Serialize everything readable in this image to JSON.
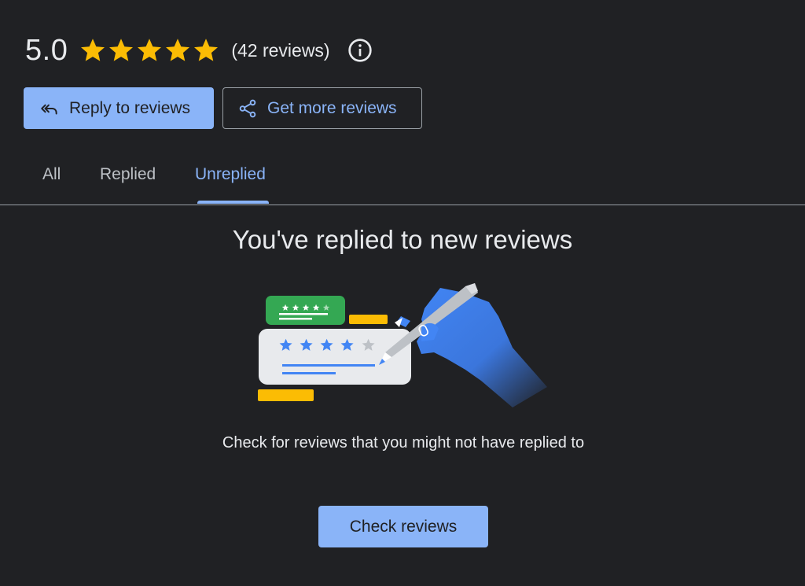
{
  "rating": {
    "value": "5.0",
    "stars": 5,
    "star_color": "#fbbc04",
    "review_count": "(42 reviews)",
    "info_icon": "info-icon"
  },
  "actions": {
    "reply_label": "Reply to reviews",
    "reply_icon": "reply-all-icon",
    "more_label": "Get more reviews",
    "more_icon": "share-icon"
  },
  "tabs": [
    {
      "label": "All",
      "selected": false
    },
    {
      "label": "Replied",
      "selected": false
    },
    {
      "label": "Unreplied",
      "selected": true
    }
  ],
  "empty_state": {
    "title": "You've replied to new reviews",
    "description": "Check for reviews that you might not have replied to",
    "button_label": "Check reviews",
    "illustration": "review-writing-illustration"
  },
  "colors": {
    "background": "#202124",
    "accent": "#8ab4f8",
    "text": "#e8eaed",
    "muted": "#bdc1c6",
    "green": "#34a853",
    "yellow": "#fbbc04",
    "blue": "#4285f4"
  }
}
